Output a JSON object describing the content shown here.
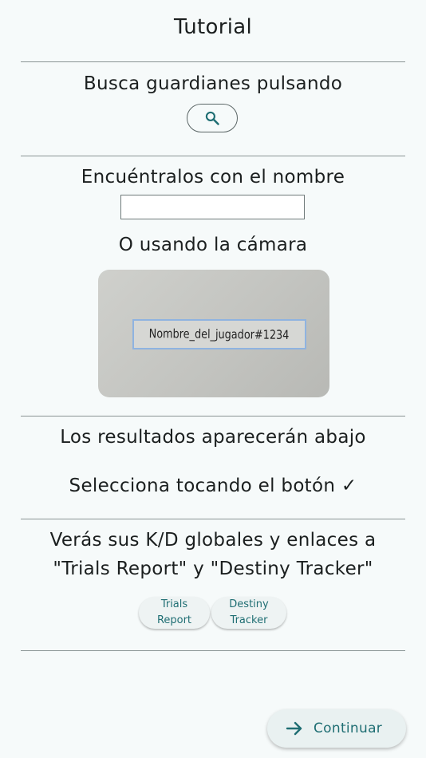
{
  "header": {
    "title": "Tutorial"
  },
  "section_search": {
    "text": "Busca guardianes pulsando",
    "button_icon": "search-icon"
  },
  "section_name": {
    "text": "Encuéntralos con el nombre",
    "input_value": "",
    "input_placeholder": ""
  },
  "section_camera": {
    "text": "O usando la cámara",
    "sample_text": "Nombre_del_jugador#1234"
  },
  "section_results": {
    "text": "Los resultados aparecerán abajo",
    "select_text": "Selecciona tocando el botón ✓"
  },
  "section_links": {
    "line1": "Verás sus K/D globales y enlaces a",
    "line2": "\"Trials Report\" y \"Destiny Tracker\"",
    "chips": [
      {
        "line1": "Trials",
        "line2": "Report"
      },
      {
        "line1": "Destiny",
        "line2": "Tracker"
      }
    ]
  },
  "footer": {
    "continue_label": "Continuar",
    "continue_icon": "arrow-right-icon"
  },
  "colors": {
    "background": "#f6fafa",
    "accent": "#1f6e73",
    "divider": "#8a9494"
  }
}
